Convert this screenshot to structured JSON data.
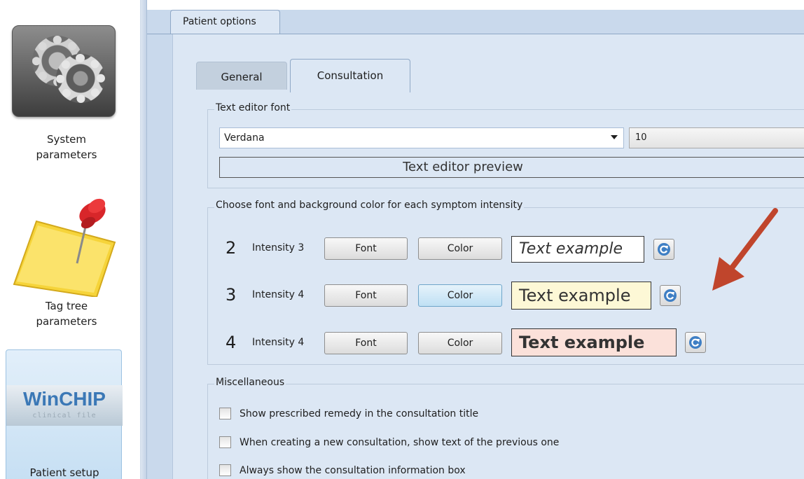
{
  "sidebar": {
    "items": [
      {
        "label": "System\nparameters",
        "icon": "gear-icon"
      },
      {
        "label": "Tag tree\nparameters",
        "icon": "pushpin-note-icon"
      },
      {
        "label": "Patient setup",
        "icon": "winchip-logo"
      }
    ],
    "logo": {
      "title": "WinCHIP",
      "subtitle": "clinical file"
    }
  },
  "outer_tab": {
    "label": "Patient options"
  },
  "inner_tabs": [
    {
      "label": "General",
      "selected": false
    },
    {
      "label": "Consultation",
      "selected": true
    }
  ],
  "text_editor_font": {
    "group_title": "Text editor font",
    "font_value": "Verdana",
    "size_value": "10",
    "preview_text": "Text editor preview"
  },
  "intensity": {
    "group_title": "Choose font and background color for each symptom intensity",
    "font_button": "Font",
    "color_button": "Color",
    "rows": [
      {
        "number": "2",
        "label": "Intensity 3",
        "sample": "Text example",
        "background": "#ffffff",
        "style": "italic"
      },
      {
        "number": "3",
        "label": "Intensity 4",
        "sample": "Text example",
        "background": "#fdf8d6",
        "style": "normal"
      },
      {
        "number": "4",
        "label": "Intensity 4",
        "sample": "Text example",
        "background": "#fbe1da",
        "style": "bold"
      }
    ]
  },
  "miscellaneous": {
    "group_title": "Miscellaneous",
    "options": [
      {
        "label": "Show prescribed remedy in the consultation title",
        "checked": false
      },
      {
        "label": "When creating a new consultation, show text of the previous one",
        "checked": false
      },
      {
        "label": "Always show the consultation information box",
        "checked": false
      }
    ]
  },
  "colors": {
    "panel_background": "#dce7f4",
    "tab_border": "#8fa8c6",
    "annotation_arrow": "#c0452c",
    "reset_icon": "#3f7fc4"
  }
}
